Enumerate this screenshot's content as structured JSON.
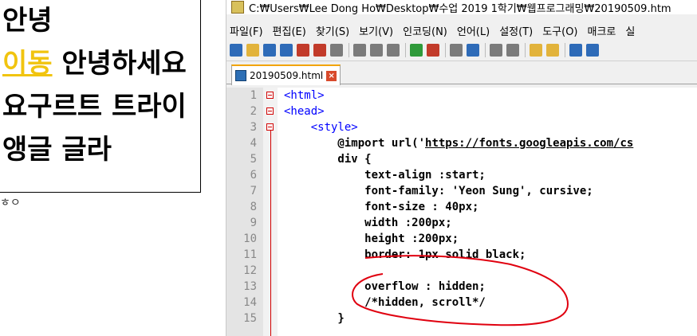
{
  "preview": {
    "text_line1": "안녕",
    "link_text": "이동",
    "text_rest": " 안녕하세요 요구르트 트라이앵글 글라",
    "below_text": "ㅎㅇ"
  },
  "window": {
    "title": "C:₩Users₩Lee Dong Ho₩Desktop₩수업 2019 1학기₩웹프로그래밍₩20190509.htm"
  },
  "menu": [
    "파일(F)",
    "편집(E)",
    "찾기(S)",
    "보기(V)",
    "인코딩(N)",
    "언어(L)",
    "설정(T)",
    "도구(O)",
    "매크로",
    "실"
  ],
  "toolbar": {
    "icons": [
      "new-file-icon",
      "open-file-icon",
      "save-icon",
      "save-all-icon",
      "close-icon",
      "close-all-icon",
      "print-icon",
      "cut-icon",
      "copy-icon",
      "paste-icon",
      "undo-icon",
      "redo-icon",
      "find-icon",
      "replace-icon",
      "zoom-in-icon",
      "zoom-out-icon",
      "sync-v-icon",
      "sync-h-icon",
      "word-wrap-icon",
      "show-all-icon"
    ],
    "colors": {
      "blue": "#2e6bb8",
      "yellow": "#e2b33b",
      "gray": "#7b7b7b",
      "green": "#2f9a3a",
      "red": "#c23b2a"
    }
  },
  "tab": {
    "label": "20190509.html",
    "close": "×"
  },
  "editor": {
    "lines": [
      {
        "n": "1",
        "segments": [
          {
            "t": "<html>",
            "c": "tag"
          }
        ]
      },
      {
        "n": "2",
        "segments": [
          {
            "t": "<head>",
            "c": "tag"
          }
        ]
      },
      {
        "n": "3",
        "segments": [
          {
            "t": "    <style>",
            "c": "tag"
          }
        ]
      },
      {
        "n": "4",
        "segments": [
          {
            "t": "        @import url('",
            "c": "kw"
          },
          {
            "t": "https://fonts.googleapis.com/cs",
            "c": "url"
          }
        ]
      },
      {
        "n": "5",
        "segments": [
          {
            "t": "        div {",
            "c": "kw"
          }
        ]
      },
      {
        "n": "6",
        "segments": [
          {
            "t": "            text-align :start;",
            "c": "kw"
          }
        ]
      },
      {
        "n": "7",
        "segments": [
          {
            "t": "            font-family: 'Yeon Sung', cursive;",
            "c": "kw"
          }
        ]
      },
      {
        "n": "8",
        "segments": [
          {
            "t": "            font-size : 40px;",
            "c": "kw"
          }
        ]
      },
      {
        "n": "9",
        "segments": [
          {
            "t": "            width :200px;",
            "c": "kw"
          }
        ]
      },
      {
        "n": "10",
        "segments": [
          {
            "t": "            height :200px;",
            "c": "kw"
          }
        ]
      },
      {
        "n": "11",
        "segments": [
          {
            "t": "            border: 1px solid black;",
            "c": "kw"
          }
        ]
      },
      {
        "n": "12",
        "segments": [
          {
            "t": "",
            "c": "kw"
          }
        ]
      },
      {
        "n": "13",
        "segments": [
          {
            "t": "            overflow : hidden;",
            "c": "kw"
          }
        ]
      },
      {
        "n": "14",
        "segments": [
          {
            "t": "            /*hidden, scroll*/",
            "c": "kw"
          }
        ]
      },
      {
        "n": "15",
        "segments": [
          {
            "t": "        }",
            "c": "kw"
          }
        ]
      }
    ]
  },
  "colors": {
    "annotation": "#e0000f",
    "link": "#f1c40f",
    "tab_accent": "#f2a400"
  }
}
